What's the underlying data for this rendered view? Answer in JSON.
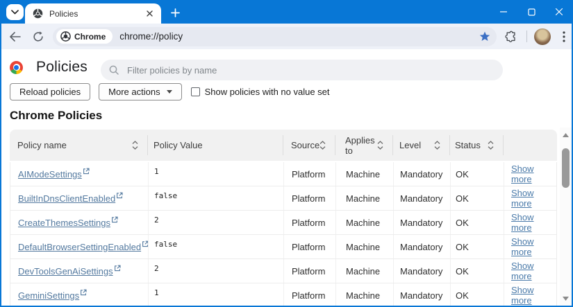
{
  "window_controls": {
    "minimize": "minimize",
    "maximize": "maximize",
    "close": "close"
  },
  "tab_strip": {
    "tab_title": "Policies"
  },
  "toolbar": {
    "chip_label": "Chrome",
    "url": "chrome://policy"
  },
  "page": {
    "title": "Policies",
    "filter_placeholder": "Filter policies by name",
    "reload_button": "Reload policies",
    "more_actions_button": "More actions",
    "checkbox_label": "Show policies with no value set",
    "checkbox_checked": false,
    "section_title": "Chrome Policies"
  },
  "colors": {
    "frame_blue": "#0877d6",
    "toolbar_bg": "#eef1f8",
    "table_header_bg": "#f1f1f1",
    "link": "#53799f",
    "star_blue": "#3b6fc4"
  },
  "table": {
    "headers": [
      {
        "label": "Policy name",
        "sortable": true
      },
      {
        "label": "Policy Value",
        "sortable": false
      },
      {
        "label": "Source",
        "sortable": true
      },
      {
        "label": "Applies to",
        "sortable": true
      },
      {
        "label": "Level",
        "sortable": true
      },
      {
        "label": "Status",
        "sortable": true
      },
      {
        "label": "",
        "sortable": false
      }
    ],
    "rows": [
      {
        "name": "AIModeSettings",
        "value": "1",
        "source": "Platform",
        "applies_to": "Machine",
        "level": "Mandatory",
        "status": "OK",
        "more": "Show more"
      },
      {
        "name": "BuiltInDnsClientEnabled",
        "value": "false",
        "source": "Platform",
        "applies_to": "Machine",
        "level": "Mandatory",
        "status": "OK",
        "more": "Show more"
      },
      {
        "name": "CreateThemesSettings",
        "value": "2",
        "source": "Platform",
        "applies_to": "Machine",
        "level": "Mandatory",
        "status": "OK",
        "more": "Show more"
      },
      {
        "name": "DefaultBrowserSettingEnabled",
        "value": "false",
        "source": "Platform",
        "applies_to": "Machine",
        "level": "Mandatory",
        "status": "OK",
        "more": "Show more"
      },
      {
        "name": "DevToolsGenAiSettings",
        "value": "2",
        "source": "Platform",
        "applies_to": "Machine",
        "level": "Mandatory",
        "status": "OK",
        "more": "Show more"
      },
      {
        "name": "GeminiSettings",
        "value": "1",
        "source": "Platform",
        "applies_to": "Machine",
        "level": "Mandatory",
        "status": "OK",
        "more": "Show more"
      }
    ]
  }
}
